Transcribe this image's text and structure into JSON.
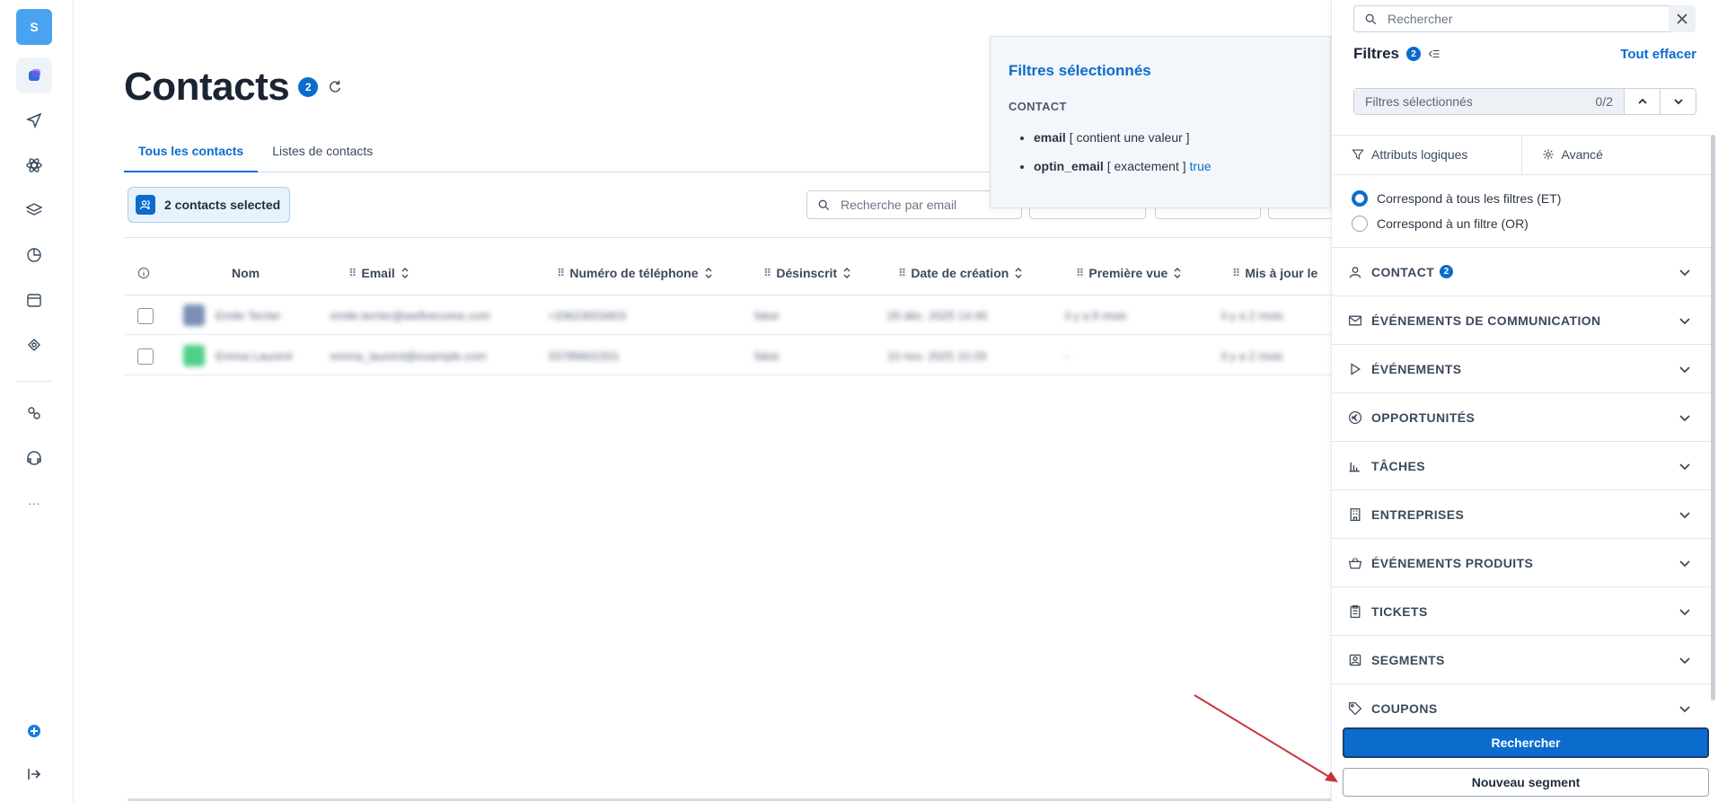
{
  "rail": {
    "logo_letter": "S",
    "more": "···"
  },
  "header": {
    "title": "Contacts",
    "count": "2"
  },
  "tabs": [
    {
      "label": "Tous les contacts"
    },
    {
      "label": "Listes de contacts"
    }
  ],
  "toolbar": {
    "selection_label": "2 contacts selected",
    "search_placeholder": "Recherche par email"
  },
  "table": {
    "columns": [
      "Nom",
      "Email",
      "Numéro de téléphone",
      "Désinscrit",
      "Date de création",
      "Première vue",
      "Mis à jour le"
    ],
    "rows": [
      [
        "Emile Terrier",
        "emile.terrier@wellvecome.com",
        "+33623003403",
        "false",
        "29 déc. 2025 14:46",
        "il y a 8 mois",
        "il y a 2 mois"
      ],
      [
        "Emma Laurent",
        "emma_laurent@example.com",
        "33789602201",
        "false",
        "10 nov. 2025 10:29",
        "-",
        "il y a 2 mois"
      ]
    ]
  },
  "popover": {
    "title": "Filtres sélectionnés",
    "section": "CONTACT",
    "items": [
      {
        "field": "email",
        "op": "[ contient une valeur ]",
        "value": ""
      },
      {
        "field": "optin_email",
        "op": "[ exactement ]",
        "value": "true"
      }
    ]
  },
  "panel": {
    "search_placeholder": "Rechercher",
    "heading": "Filtres",
    "heading_count": "2",
    "clear_all": "Tout effacer",
    "selected_label": "Filtres sélectionnés",
    "selected_count": "0/2",
    "tab_logic": "Attributs logiques",
    "tab_advanced": "Avancé",
    "match_all": "Correspond à tous les filtres (ET)",
    "match_any": "Correspond à un filtre (OR)",
    "sections": [
      {
        "label": "CONTACT",
        "icon": "person-icon",
        "badge": "2"
      },
      {
        "label": "ÉVÉNEMENTS DE COMMUNICATION",
        "icon": "mail-icon"
      },
      {
        "label": "ÉVÉNEMENTS",
        "icon": "play-icon"
      },
      {
        "label": "OPPORTUNITÉS",
        "icon": "euro-icon"
      },
      {
        "label": "TÂCHES",
        "icon": "bars-icon"
      },
      {
        "label": "ENTREPRISES",
        "icon": "building-icon"
      },
      {
        "label": "ÉVÉNEMENTS PRODUITS",
        "icon": "basket-icon"
      },
      {
        "label": "TICKETS",
        "icon": "ticket-icon"
      },
      {
        "label": "SEGMENTS",
        "icon": "segment-icon"
      },
      {
        "label": "COUPONS",
        "icon": "tag-icon"
      }
    ],
    "search_button": "Rechercher",
    "new_segment_button": "Nouveau segment"
  },
  "colors": {
    "accent": "#0b6cce",
    "annotation_arrow": "#c8323a"
  }
}
